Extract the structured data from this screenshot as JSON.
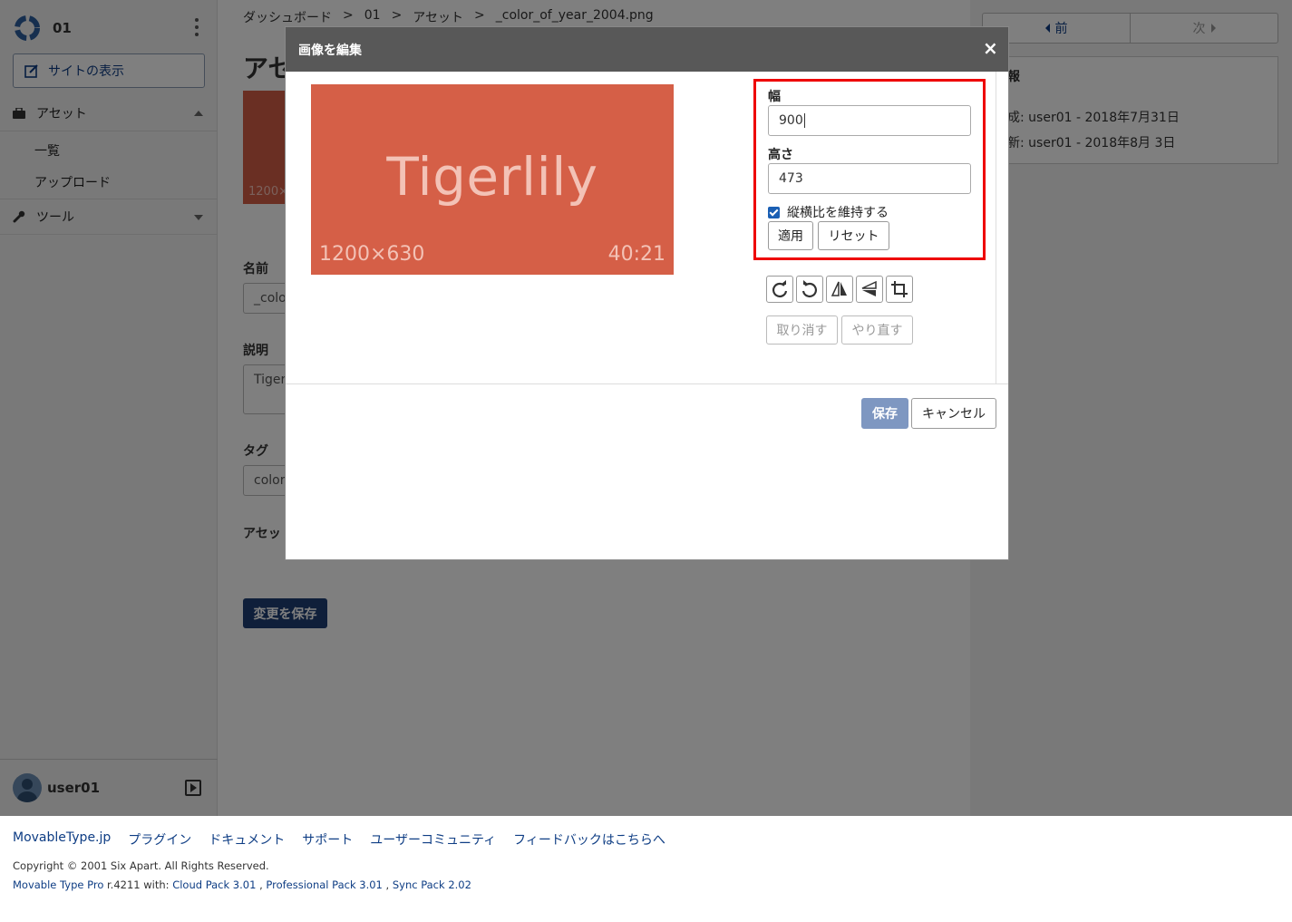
{
  "sidebar": {
    "site_name": "01",
    "view_site": "サイトの表示",
    "nav": {
      "assets": "アセット",
      "list": "一覧",
      "upload": "アップロード",
      "tools": "ツール"
    },
    "user": "user01"
  },
  "main": {
    "breadcrumb": [
      "ダッシュボード",
      ">",
      "01",
      ">",
      "アセット",
      ">",
      "_color_of_year_2004.png"
    ],
    "title": "アセ",
    "thumb_text": "1200×",
    "fields": {
      "name_label": "名前",
      "name_value": "_colo",
      "desc_label": "説明",
      "desc_value": "Tiger",
      "tag_label": "タグ",
      "tag_value": "color-",
      "asset_label": "アセッ"
    },
    "save_changes": "変更を保存"
  },
  "right": {
    "prev": "前",
    "next": "次",
    "info_title": "報",
    "created": "成: user01 - 2018年7月31日",
    "updated": "新: user01 - 2018年8月 3日"
  },
  "modal": {
    "title": "画像を編集",
    "close": "×",
    "preview": {
      "text": "Tigerlily",
      "dims": "1200×630",
      "ratio": "40:21",
      "color": "#d55f47"
    },
    "width_label": "幅",
    "width_value": "900",
    "height_label": "高さ",
    "height_value": "473",
    "keep_ratio": "縦横比を維持する",
    "keep_ratio_checked": true,
    "apply": "適用",
    "reset": "リセット",
    "tools": [
      "rotate-right-icon",
      "rotate-left-icon",
      "flip-horizontal-icon",
      "flip-vertical-icon",
      "crop-icon"
    ],
    "undo": "取り消す",
    "redo": "やり直す",
    "save": "保存",
    "cancel": "キャンセル"
  },
  "footer": {
    "links": [
      "MovableType.jp",
      "プラグイン",
      "ドキュメント",
      "サポート",
      "ユーザーコミュニティ",
      "フィードバックはこちらへ"
    ],
    "copyright": "Copyright © 2001 Six Apart. All Rights Reserved.",
    "product": "Movable Type Pro",
    "version_text": " r.4211 with: ",
    "packs": [
      "Cloud Pack 3.01",
      "Professional Pack 3.01",
      "Sync Pack 2.02"
    ]
  }
}
